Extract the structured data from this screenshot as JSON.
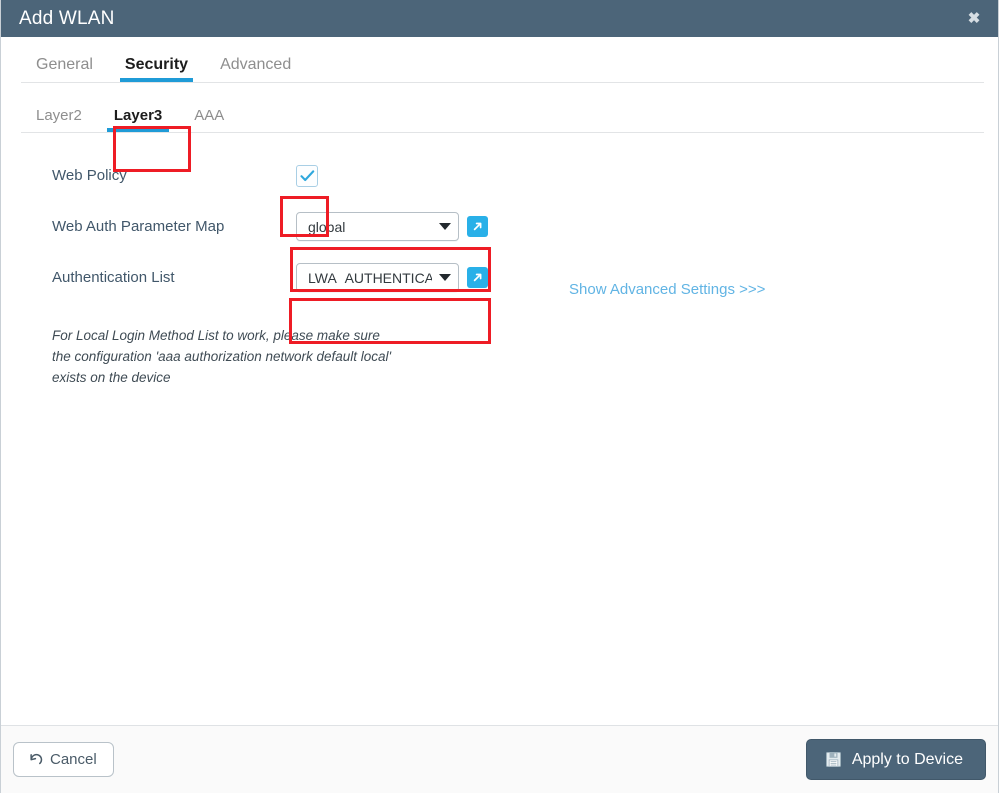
{
  "window": {
    "title": "Add WLAN",
    "close_label": "✖"
  },
  "tabs_main": [
    {
      "label": "General",
      "active": false
    },
    {
      "label": "Security",
      "active": true
    },
    {
      "label": "Advanced",
      "active": false
    }
  ],
  "tabs_sub": [
    {
      "label": "Layer2",
      "active": false
    },
    {
      "label": "Layer3",
      "active": true
    },
    {
      "label": "AAA",
      "active": false
    }
  ],
  "form": {
    "web_policy": {
      "label": "Web Policy",
      "checked": true
    },
    "web_auth_parameter_map": {
      "label": "Web Auth Parameter Map",
      "value": "global"
    },
    "authentication_list": {
      "label": "Authentication List",
      "value": "LWA_AUTHENTICATION"
    }
  },
  "advanced_link": {
    "label": "Show Advanced Settings >>>"
  },
  "note": {
    "line1": "For Local Login Method List to work, please make sure",
    "line2": "the configuration 'aaa authorization network default local'",
    "line3": "exists on the device"
  },
  "footer": {
    "cancel_label": "Cancel",
    "apply_label": "Apply to Device"
  },
  "colors": {
    "titlebar": "#4c6579",
    "accent_blue": "#1f9bd7",
    "link_blue": "#61b4e4",
    "ext_link_icon": "#29b0e8",
    "highlight_red": "#ee1c25",
    "apply_button": "#4c6579",
    "label_text": "#41576a"
  },
  "icons": {
    "close": "close-icon",
    "checkmark": "checkmark-icon",
    "caret": "chevron-down-icon",
    "external_link": "external-link-icon",
    "undo": "undo-icon",
    "save": "save-icon"
  }
}
